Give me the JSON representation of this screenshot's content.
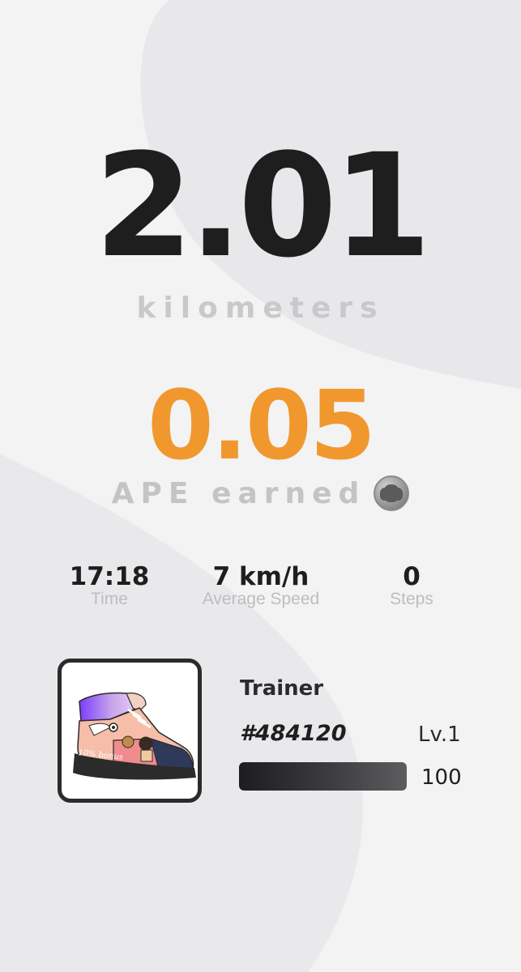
{
  "distance": {
    "value": "2.01",
    "unit": "kilometers"
  },
  "earnings": {
    "value": "0.05",
    "label": "APE earned",
    "icon": "ape-coin-icon"
  },
  "stats": {
    "time": {
      "value": "17:18",
      "label": "Time"
    },
    "speed": {
      "value": "7 km/h",
      "label": "Average Speed"
    },
    "steps": {
      "value": "0",
      "label": "Steps"
    }
  },
  "sneaker": {
    "type": "Trainer",
    "id": "#484120",
    "level": "Lv.1",
    "durability_value": "100",
    "durability_fraction": 1.0,
    "bonus_text": "10% bonus",
    "icon": "sneaker-image"
  },
  "colors": {
    "background": "#f3f3f4",
    "accent": "#f0982e",
    "primary_text": "#1e1e1e",
    "muted_text": "#c4c4c6"
  }
}
